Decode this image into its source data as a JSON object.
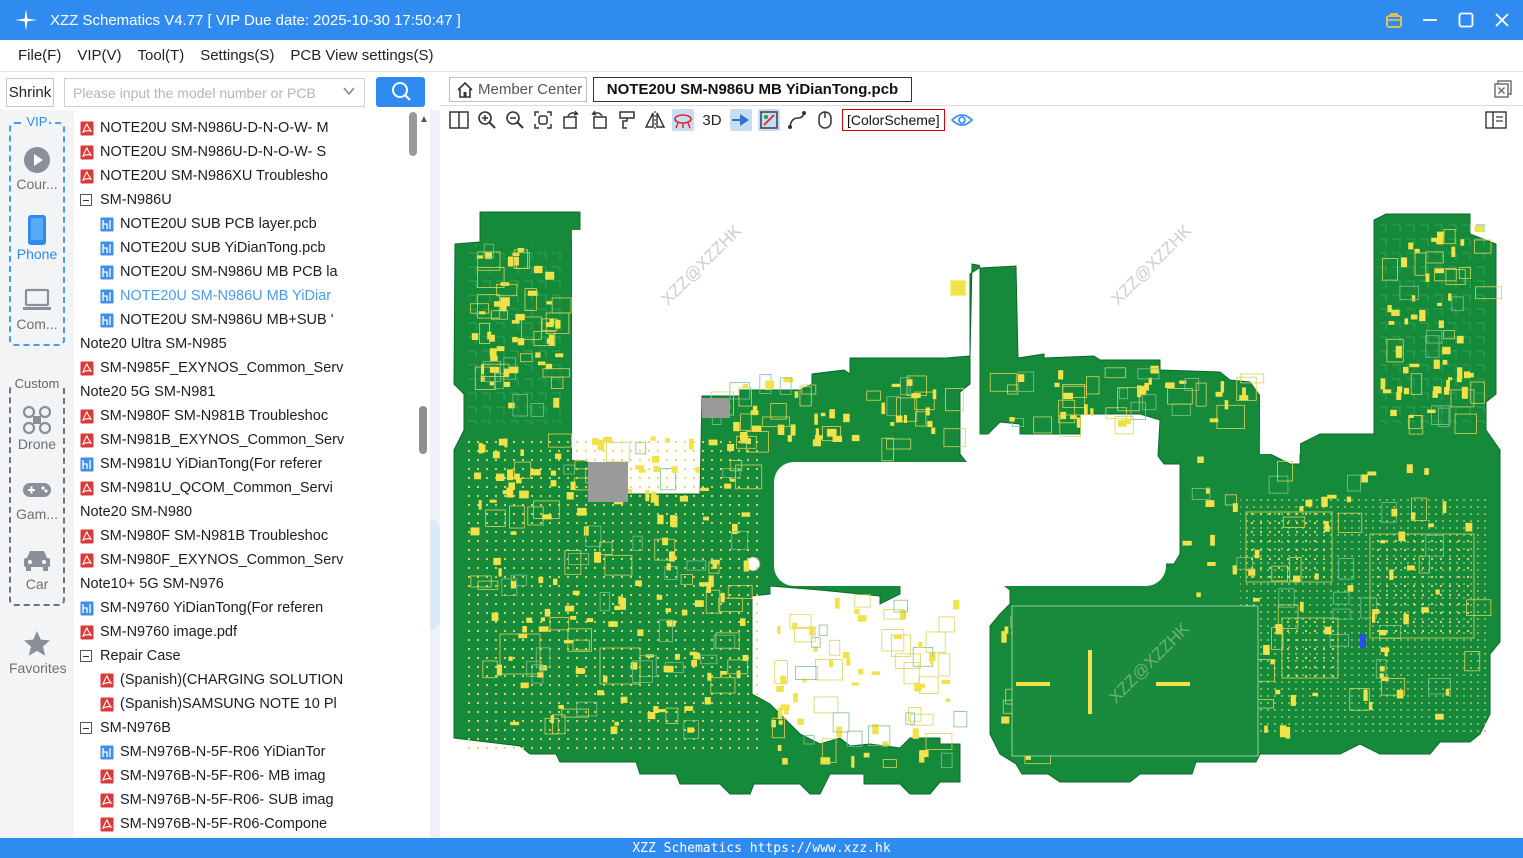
{
  "titlebar": {
    "title": "XZZ Schematics V4.77 [ VIP Due date: 2025-10-30 17:50:47 ]"
  },
  "menu": [
    "File(F)",
    "VIP(V)",
    "Tool(T)",
    "Settings(S)",
    "PCB View settings(S)"
  ],
  "search": {
    "shrink_label": "Shrink",
    "placeholder": "Please input the model number or PCB"
  },
  "leftnav": {
    "vip_title": "VIP",
    "custom_title": "Custom",
    "vip_items": [
      {
        "label": "Cour...",
        "icon": "play-icon"
      },
      {
        "label": "Phone",
        "icon": "phone-icon"
      },
      {
        "label": "Com...",
        "icon": "laptop-icon"
      }
    ],
    "custom_items": [
      {
        "label": "Drone",
        "icon": "drone-icon"
      },
      {
        "label": "Gam...",
        "icon": "gamepad-icon"
      },
      {
        "label": "Car",
        "icon": "car-icon"
      }
    ],
    "favorites": "Favorites"
  },
  "tree": [
    {
      "label": "NOTE20U SM-N986U-D-N-O-W- M",
      "type": "pdf",
      "level": 2
    },
    {
      "label": "NOTE20U SM-N986U-D-N-O-W- S",
      "type": "pdf",
      "level": 2
    },
    {
      "label": "NOTE20U SM-N986XU Troublesho",
      "type": "pdf",
      "level": 2
    },
    {
      "label": "SM-N986U",
      "type": "folder",
      "level": 2
    },
    {
      "label": "NOTE20U  SUB PCB layer.pcb",
      "type": "pcb",
      "level": 3
    },
    {
      "label": "NOTE20U  SUB YiDianTong.pcb",
      "type": "pcb",
      "level": 3
    },
    {
      "label": "NOTE20U SM-N986U MB PCB la",
      "type": "pcb",
      "level": 3
    },
    {
      "label": "NOTE20U SM-N986U MB YiDiar",
      "type": "pcb",
      "level": 3,
      "selected": true
    },
    {
      "label": "NOTE20U SM-N986U MB+SUB '",
      "type": "pcb",
      "level": 3
    },
    {
      "label": "Note20 Ultra SM-N985",
      "type": "folder",
      "level": 1
    },
    {
      "label": "SM-N985F_EXYNOS_Common_Serv",
      "type": "pdf",
      "level": 2
    },
    {
      "label": "Note20 5G SM-N981",
      "type": "folder",
      "level": 1
    },
    {
      "label": "SM-N980F SM-N981B Troubleshoc",
      "type": "pdf",
      "level": 2
    },
    {
      "label": "SM-N981B_EXYNOS_Common_Serv",
      "type": "pdf",
      "level": 2
    },
    {
      "label": "SM-N981U YiDianTong(For referer",
      "type": "pcb",
      "level": 2
    },
    {
      "label": "SM-N981U_QCOM_Common_Servi",
      "type": "pdf",
      "level": 2
    },
    {
      "label": "Note20 SM-N980",
      "type": "folder",
      "level": 1
    },
    {
      "label": "SM-N980F SM-N981B Troubleshoc",
      "type": "pdf",
      "level": 2
    },
    {
      "label": "SM-N980F_EXYNOS_Common_Serv",
      "type": "pdf",
      "level": 2
    },
    {
      "label": "Note10+ 5G SM-N976",
      "type": "folder",
      "level": 1
    },
    {
      "label": "SM-N9760 YiDianTong(For referen",
      "type": "pcb",
      "level": 2
    },
    {
      "label": "SM-N9760 image.pdf",
      "type": "pdf",
      "level": 2
    },
    {
      "label": "Repair Case",
      "type": "folder",
      "level": 2
    },
    {
      "label": "(Spanish)(CHARGING SOLUTION",
      "type": "pdf",
      "level": 3
    },
    {
      "label": "(Spanish)SAMSUNG NOTE 10 Pl",
      "type": "pdf",
      "level": 3
    },
    {
      "label": "SM-N976B",
      "type": "folder",
      "level": 2
    },
    {
      "label": "SM-N976B-N-5F-R06 YiDianTor",
      "type": "pcb",
      "level": 3
    },
    {
      "label": "SM-N976B-N-5F-R06- MB imag",
      "type": "pdf",
      "level": 3
    },
    {
      "label": "SM-N976B-N-5F-R06- SUB imag",
      "type": "pdf",
      "level": 3
    },
    {
      "label": "SM-N976B-N-5F-R06-Compone",
      "type": "pdf",
      "level": 3
    }
  ],
  "tabs": {
    "member": "Member Center",
    "active": "NOTE20U SM-N986U MB YiDianTong.pcb"
  },
  "toolbar": {
    "label_3d": "3D",
    "color_scheme": "[ColorScheme]"
  },
  "canvas": {
    "watermark": "XZZ@XZZHK",
    "pcb_green": "#1a8a3c",
    "pad_yellow": "#f2e24a",
    "pad_gray": "#9a9a9a",
    "trace_green": "#7fc18f"
  },
  "statusbar": {
    "text": "XZZ Schematics https://www.xzz.hk"
  },
  "colors": {
    "accent": "#2f8bf0",
    "pdf_red": "#d93a3a"
  }
}
